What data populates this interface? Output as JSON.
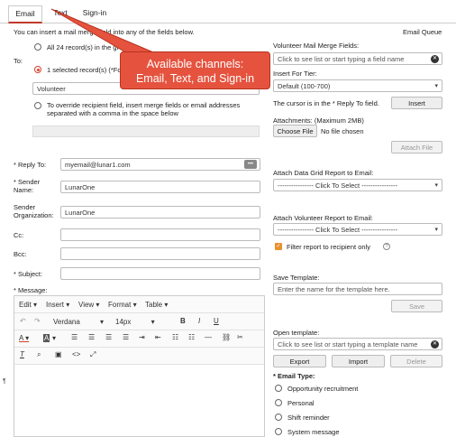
{
  "tabs": [
    {
      "label": "Email"
    },
    {
      "label": "Text"
    },
    {
      "label": "Sign-in"
    }
  ],
  "notice": "You can insert a mail merge field into any of the fields below.",
  "email_queue": "Email Queue",
  "to": {
    "label": "To:",
    "option_all": "All 24 record(s) in the gr",
    "option_selected": "1 selected record(s) (*Fo",
    "volunteer_value": "Volunteer",
    "override_text": "To override recipient field, insert merge fields or email addresses separated with a comma in the space below"
  },
  "callout": {
    "line1": "Available channels:",
    "line2": "Email, Text, and Sign-in"
  },
  "reply_to": {
    "label": "* Reply To:",
    "value": "myemail@lunar1.com",
    "dots": "•••"
  },
  "sender_name": {
    "label": "* Sender Name:",
    "value": "LunarOne"
  },
  "sender_org": {
    "label": "Sender Organization:",
    "value": "LunarOne"
  },
  "cc": {
    "label": "Cc:"
  },
  "bcc": {
    "label": "Bcc:"
  },
  "subject": {
    "label": "* Subject:"
  },
  "message_label": "* Message:",
  "editor": {
    "menus": [
      "Edit",
      "Insert",
      "View",
      "Format",
      "Table"
    ],
    "font": "Verdana",
    "size": "14px",
    "bold": "B",
    "italic": "I",
    "underline": "U",
    "cut_glyph": "¶"
  },
  "right": {
    "merge_label": "Volunteer Mail Merge Fields:",
    "merge_placeholder": "Click to see list or start typing a field name",
    "tier_label": "Insert For Tier:",
    "tier_value": "Default (100-700)",
    "cursor_text": "The cursor is in the * Reply To field.",
    "insert_btn": "Insert",
    "attach_label": "Attachments:  (Maximum 2MB)",
    "choose_file": "Choose File",
    "no_file": "No file chosen",
    "attach_btn": "Attach File",
    "grid_label": "Attach Data Grid Report to Email:",
    "grid_value": "---------------- Click To Select ----------------",
    "vol_report_label": "Attach Volunteer Report to Email:",
    "vol_report_value": "---------------- Click To Select ----------------",
    "filter_label": "Filter report to recipient only",
    "save_template_label": "Save Template:",
    "save_template_ph": "Enter the name for the template here.",
    "save_btn": "Save",
    "open_template_label": "Open template:",
    "open_template_ph": "Click to see list or start typing a template name",
    "export_btn": "Export",
    "import_btn": "Import",
    "delete_btn": "Delete",
    "email_type_label": "* Email Type:",
    "email_types": [
      "Opportunity recruitment",
      "Personal",
      "Shift reminder",
      "System message"
    ]
  },
  "colors": {
    "accent": "#d9402b",
    "link": "#1a6fc4",
    "callout": "#e5533f"
  }
}
